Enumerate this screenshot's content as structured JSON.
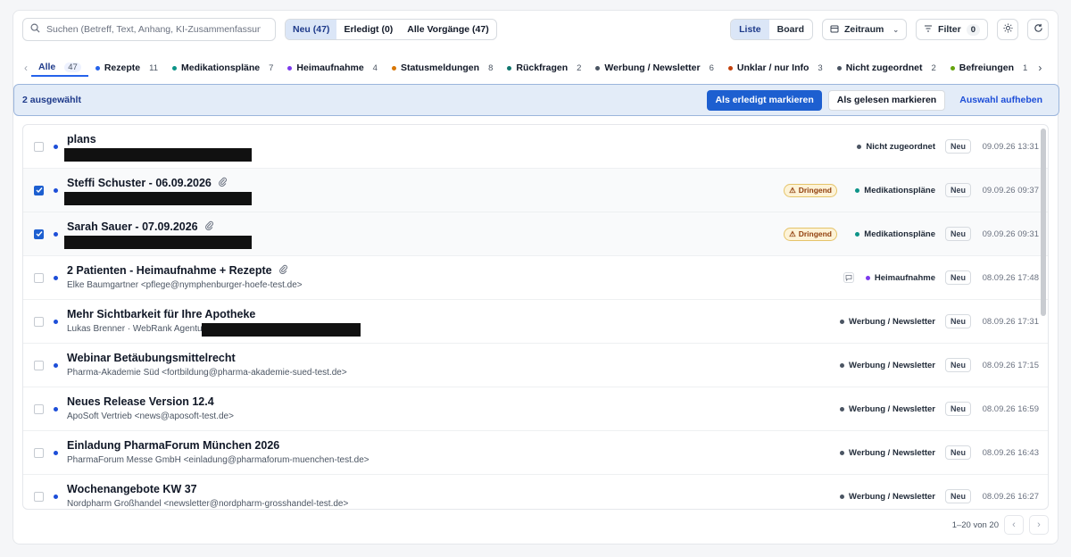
{
  "search": {
    "placeholder": "Suchen (Betreff, Text, Anhang, KI-Zusammenfassung) ..."
  },
  "status_tabs": [
    {
      "label": "Neu (47)",
      "active": true
    },
    {
      "label": "Erledigt (0)",
      "active": false
    },
    {
      "label": "Alle Vorgänge (47)",
      "active": false
    }
  ],
  "view": {
    "list": "Liste",
    "board": "Board"
  },
  "zeitraum": "Zeitraum",
  "filter": {
    "label": "Filter",
    "count": "0"
  },
  "categories": [
    {
      "label": "Alle",
      "count": "47",
      "color": "",
      "active": true
    },
    {
      "label": "Rezepte",
      "count": "11",
      "color": "#2563eb"
    },
    {
      "label": "Medikationspläne",
      "count": "7",
      "color": "#0d9488"
    },
    {
      "label": "Heimaufnahme",
      "count": "4",
      "color": "#7c3aed"
    },
    {
      "label": "Statusmeldungen",
      "count": "8",
      "color": "#d97706"
    },
    {
      "label": "Rückfragen",
      "count": "2",
      "color": "#0f766e"
    },
    {
      "label": "Werbung / Newsletter",
      "count": "6",
      "color": "#4b5563"
    },
    {
      "label": "Unklar / nur Info",
      "count": "3",
      "color": "#c2410c"
    },
    {
      "label": "Nicht zugeordnet",
      "count": "2",
      "color": "#4b5563"
    },
    {
      "label": "Befreiungen",
      "count": "1",
      "color": "#65a30d"
    }
  ],
  "selection": {
    "label": "2 ausgewählt",
    "mark_done": "Als erledigt markieren",
    "mark_read": "Als gelesen markieren",
    "clear": "Auswahl aufheben"
  },
  "rows": [
    {
      "subject": "plans",
      "sender": "",
      "category": "Nicht zugeordnet",
      "cat_color": "#4b5563",
      "status": "Neu",
      "time": "09.09.26 13:31",
      "checked": false,
      "urgent": "",
      "attachment": false
    },
    {
      "subject": "Steffi Schuster - 06.09.2026",
      "sender": "",
      "category": "Medikationspläne",
      "cat_color": "#0d9488",
      "status": "Neu",
      "time": "09.09.26 09:37",
      "checked": true,
      "urgent": "Dringend",
      "attachment": true
    },
    {
      "subject": "Sarah Sauer - 07.09.2026",
      "sender": "",
      "category": "Medikationspläne",
      "cat_color": "#0d9488",
      "status": "Neu",
      "time": "09.09.26 09:31",
      "checked": true,
      "urgent": "Dringend",
      "attachment": true
    },
    {
      "subject": "2 Patienten - Heimaufnahme + Rezepte",
      "sender": "Elke Baumgartner <pflege@nymphenburger-hoefe-test.de>",
      "category": "Heimaufnahme",
      "cat_color": "#7c3aed",
      "status": "Neu",
      "time": "08.09.26 17:48",
      "checked": false,
      "urgent": "",
      "attachment": true
    },
    {
      "subject": "Mehr Sichtbarkeit für Ihre Apotheke",
      "sender": "Lukas Brenner · WebRank Agentur",
      "category": "Werbung / Newsletter",
      "cat_color": "#4b5563",
      "status": "Neu",
      "time": "08.09.26 17:31",
      "checked": false,
      "urgent": "",
      "attachment": false
    },
    {
      "subject": "Webinar Betäubungsmittelrecht",
      "sender": "Pharma-Akademie Süd <fortbildung@pharma-akademie-sued-test.de>",
      "category": "Werbung / Newsletter",
      "cat_color": "#4b5563",
      "status": "Neu",
      "time": "08.09.26 17:15",
      "checked": false,
      "urgent": "",
      "attachment": false
    },
    {
      "subject": "Neues Release Version 12.4",
      "sender": "ApoSoft Vertrieb <news@aposoft-test.de>",
      "category": "Werbung / Newsletter",
      "cat_color": "#4b5563",
      "status": "Neu",
      "time": "08.09.26 16:59",
      "checked": false,
      "urgent": "",
      "attachment": false
    },
    {
      "subject": "Einladung PharmaForum München 2026",
      "sender": "PharmaForum Messe GmbH <einladung@pharmaforum-muenchen-test.de>",
      "category": "Werbung / Newsletter",
      "cat_color": "#4b5563",
      "status": "Neu",
      "time": "08.09.26 16:43",
      "checked": false,
      "urgent": "",
      "attachment": false
    },
    {
      "subject": "Wochenangebote KW 37",
      "sender": "Nordpharm Großhandel <newsletter@nordpharm-grosshandel-test.de>",
      "category": "Werbung / Newsletter",
      "cat_color": "#4b5563",
      "status": "Neu",
      "time": "08.09.26 16:27",
      "checked": false,
      "urgent": "",
      "attachment": false
    }
  ],
  "pagination": {
    "label": "1–20 von 20"
  }
}
